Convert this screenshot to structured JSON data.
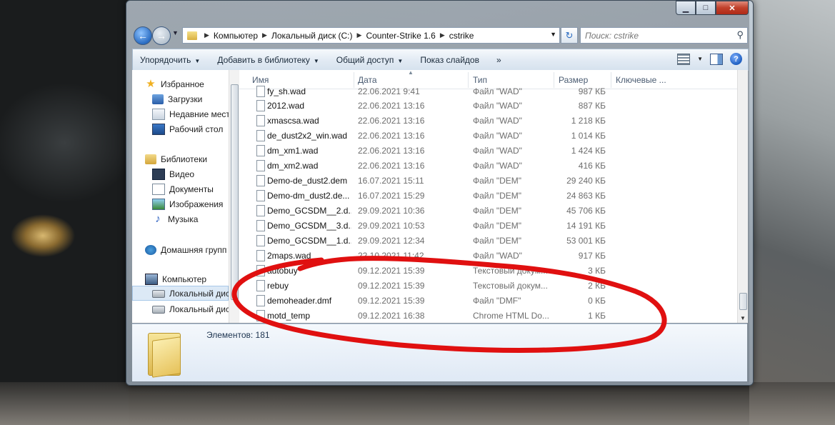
{
  "window": {
    "min_glyph": "▁",
    "max_glyph": "□",
    "close_glyph": "✕"
  },
  "nav": {
    "crumbs": [
      "Компьютер",
      "Локальный диск (C:)",
      "Counter-Strike 1.6",
      "cstrike"
    ],
    "search_placeholder": "Поиск: cstrike"
  },
  "toolbar": {
    "organize": "Упорядочить",
    "add_to_library": "Добавить в библиотеку",
    "share": "Общий доступ",
    "slideshow": "Показ слайдов",
    "more": "»"
  },
  "sidebar": {
    "favorites": "Избранное",
    "downloads": "Загрузки",
    "recent": "Недавние мест",
    "desktop": "Рабочий стол",
    "libraries": "Библиотеки",
    "video": "Видео",
    "documents": "Документы",
    "images": "Изображения",
    "music": "Музыка",
    "homegroup": "Домашняя групп",
    "computer": "Компьютер",
    "disk1": "Локальный дис",
    "disk2": "Локальный дис"
  },
  "columns": {
    "name": "Имя",
    "date": "Дата",
    "type": "Тип",
    "size": "Размер",
    "keywords": "Ключевые ..."
  },
  "files": [
    {
      "name": "fy_sh.wad",
      "date": "22.06.2021 9:41",
      "type": "Файл \"WAD\"",
      "size": "987 КБ"
    },
    {
      "name": "2012.wad",
      "date": "22.06.2021 13:16",
      "type": "Файл \"WAD\"",
      "size": "887 КБ"
    },
    {
      "name": "xmascsa.wad",
      "date": "22.06.2021 13:16",
      "type": "Файл \"WAD\"",
      "size": "1 218 КБ"
    },
    {
      "name": "de_dust2x2_win.wad",
      "date": "22.06.2021 13:16",
      "type": "Файл \"WAD\"",
      "size": "1 014 КБ"
    },
    {
      "name": "dm_xm1.wad",
      "date": "22.06.2021 13:16",
      "type": "Файл \"WAD\"",
      "size": "1 424 КБ"
    },
    {
      "name": "dm_xm2.wad",
      "date": "22.06.2021 13:16",
      "type": "Файл \"WAD\"",
      "size": "416 КБ"
    },
    {
      "name": "Demo-de_dust2.dem",
      "date": "16.07.2021 15:11",
      "type": "Файл \"DEM\"",
      "size": "29 240 КБ"
    },
    {
      "name": "Demo-dm_dust2.de...",
      "date": "16.07.2021 15:29",
      "type": "Файл \"DEM\"",
      "size": "24 863 КБ"
    },
    {
      "name": "Demo_GCSDM__2.d...",
      "date": "29.09.2021 10:36",
      "type": "Файл \"DEM\"",
      "size": "45 706 КБ"
    },
    {
      "name": "Demo_GCSDM__3.d...",
      "date": "29.09.2021 10:53",
      "type": "Файл \"DEM\"",
      "size": "14 191 КБ"
    },
    {
      "name": "Demo_GCSDM__1.d...",
      "date": "29.09.2021 12:34",
      "type": "Файл \"DEM\"",
      "size": "53 001 КБ"
    },
    {
      "name": "2maps.wad",
      "date": "22.10.2021 11:42",
      "type": "Файл \"WAD\"",
      "size": "917 КБ"
    },
    {
      "name": "autobuy",
      "date": "09.12.2021 15:39",
      "type": "Текстовый докум...",
      "size": "3 КБ"
    },
    {
      "name": "rebuy",
      "date": "09.12.2021 15:39",
      "type": "Текстовый докум...",
      "size": "2 КБ"
    },
    {
      "name": "demoheader.dmf",
      "date": "09.12.2021 15:39",
      "type": "Файл \"DMF\"",
      "size": "0 КБ"
    },
    {
      "name": "motd_temp",
      "date": "09.12.2021 16:38",
      "type": "Chrome HTML Do...",
      "size": "1 КБ"
    }
  ],
  "details": {
    "items_count": "Элементов: 181"
  },
  "annotation_color": "#e01010"
}
